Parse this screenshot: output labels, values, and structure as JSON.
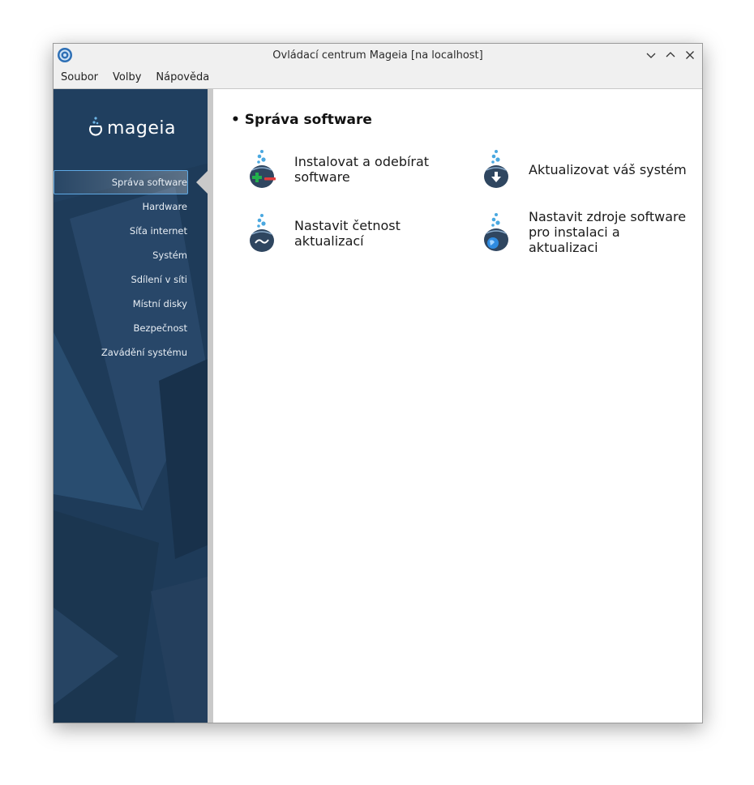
{
  "window": {
    "title": "Ovládací centrum Mageia [na localhost]",
    "controls": [
      "minimize-icon",
      "maximize-icon",
      "close-icon"
    ]
  },
  "menubar": [
    "Soubor",
    "Volby",
    "Nápověda"
  ],
  "sidebar": {
    "logo": "mageia",
    "items": [
      {
        "label": "Správa software",
        "active": true
      },
      {
        "label": "Hardware"
      },
      {
        "label": "Síťa internet"
      },
      {
        "label": "Systém"
      },
      {
        "label": "Sdílení v síti"
      },
      {
        "label": "Místní disky"
      },
      {
        "label": "Bezpečnost"
      },
      {
        "label": "Zavádění systému"
      }
    ]
  },
  "main": {
    "section_title": "• Správa software",
    "tools": [
      {
        "label": "Instalovat a odebírat software",
        "icon": "install-remove-icon"
      },
      {
        "label": "Aktualizovat váš systém",
        "icon": "update-system-icon"
      },
      {
        "label": "Nastavit četnost aktualizací",
        "icon": "update-frequency-icon"
      },
      {
        "label": "Nastavit zdroje software pro instalaci a aktualizaci",
        "icon": "software-sources-icon"
      }
    ]
  },
  "colors": {
    "sidebar": "#1f3d5c",
    "accent": "#5fa9e4"
  }
}
